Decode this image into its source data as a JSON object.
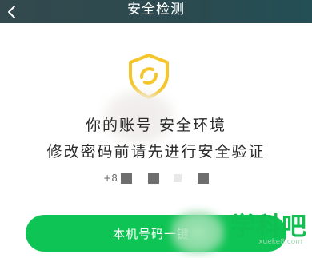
{
  "header": {
    "title": "安全检测",
    "back_icon": "chevron-left-icon",
    "background": "#2b4a4f"
  },
  "shield": {
    "icon": "shield-refresh-icon",
    "color": "#f5c62b"
  },
  "message": {
    "line1": "你的账号            安全环境",
    "line2": "修改密码前请先进行安全验证"
  },
  "phone": {
    "prefix": "+8"
  },
  "action": {
    "label": "本机号码一键",
    "color": "#0ec454"
  },
  "watermark": {
    "main": "学科吧",
    "sub": "xueke8.com"
  }
}
